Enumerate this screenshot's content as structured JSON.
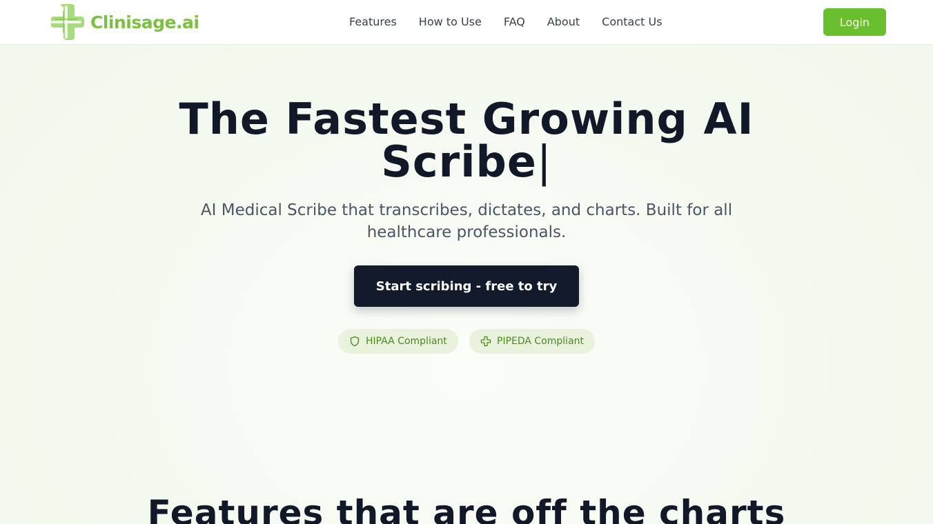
{
  "header": {
    "logo_text": "Clinisage.ai",
    "nav": [
      {
        "label": "Features"
      },
      {
        "label": "How to Use"
      },
      {
        "label": "FAQ"
      },
      {
        "label": "About"
      },
      {
        "label": "Contact Us"
      }
    ],
    "login_label": "Login"
  },
  "hero": {
    "title": "The Fastest Growing AI Scribe",
    "cursor": "|",
    "subtitle": "AI Medical Scribe that transcribes, dictates, and charts. Built for all healthcare professionals.",
    "cta_label": "Start scribing - free to try",
    "badges": [
      {
        "label": "HIPAA Compliant",
        "icon": "shield-icon"
      },
      {
        "label": "PIPEDA Compliant",
        "icon": "medical-cross-icon"
      }
    ]
  },
  "features": {
    "title": "Features that are off the charts"
  },
  "colors": {
    "brand_green": "#6abf2e",
    "logo_green": "#7bc043",
    "dark_navy": "#131a2b",
    "badge_bg": "#e8f2dd",
    "badge_text": "#4d8a1f"
  }
}
